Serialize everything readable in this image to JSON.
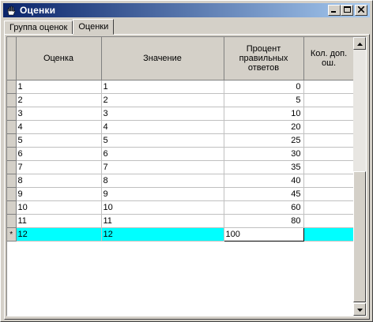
{
  "window": {
    "title": "Оценки"
  },
  "tabs": [
    {
      "label": "Группа оценок",
      "active": false
    },
    {
      "label": "Оценки",
      "active": true
    }
  ],
  "grid": {
    "columns": [
      "",
      "Оценка",
      "Значение",
      "Процент правильных ответов",
      "Кол. доп. ош."
    ],
    "rows": [
      {
        "indicator": "",
        "grade": "1",
        "value": "1",
        "percent": "0",
        "extra": ""
      },
      {
        "indicator": "",
        "grade": "2",
        "value": "2",
        "percent": "5",
        "extra": ""
      },
      {
        "indicator": "",
        "grade": "3",
        "value": "3",
        "percent": "10",
        "extra": ""
      },
      {
        "indicator": "",
        "grade": "4",
        "value": "4",
        "percent": "20",
        "extra": ""
      },
      {
        "indicator": "",
        "grade": "5",
        "value": "5",
        "percent": "25",
        "extra": ""
      },
      {
        "indicator": "",
        "grade": "6",
        "value": "6",
        "percent": "30",
        "extra": ""
      },
      {
        "indicator": "",
        "grade": "7",
        "value": "7",
        "percent": "35",
        "extra": ""
      },
      {
        "indicator": "",
        "grade": "8",
        "value": "8",
        "percent": "40",
        "extra": ""
      },
      {
        "indicator": "",
        "grade": "9",
        "value": "9",
        "percent": "45",
        "extra": ""
      },
      {
        "indicator": "",
        "grade": "10",
        "value": "10",
        "percent": "60",
        "extra": ""
      },
      {
        "indicator": "",
        "grade": "11",
        "value": "11",
        "percent": "80",
        "extra": ""
      },
      {
        "indicator": "*",
        "grade": "12",
        "value": "12",
        "percent": "100",
        "extra": ""
      }
    ]
  },
  "icons": {
    "window": "hand-icon",
    "minimize": "minimize-icon",
    "maximize": "maximize-icon",
    "close": "close-icon"
  },
  "colors": {
    "titlebar_start": "#0a246a",
    "titlebar_end": "#a6caf0",
    "selection": "#00ffff"
  }
}
